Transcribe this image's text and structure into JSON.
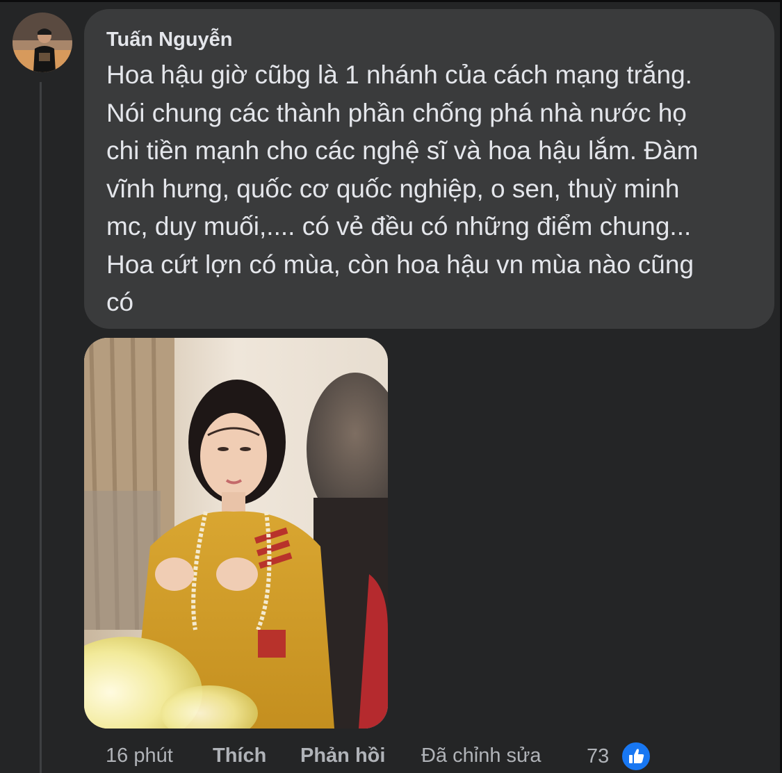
{
  "comment": {
    "author": "Tuấn Nguyễn",
    "lines": [
      "Hoa hậu giờ cũbg là 1 nhánh của cách mạng trắng.",
      "Nói chung các thành phần chống phá nhà nước họ",
      "chi tiền mạnh cho các nghệ sĩ và hoa hậu lắm. Đàm",
      "vĩnh hưng, quốc cơ quốc nghiệp, o sen, thuỳ minh",
      "mc, duy muối,.... có vẻ đều có những điểm chung...",
      "Hoa cứt lợn có mùa, còn hoa hậu vn mùa nào cũng",
      "có"
    ]
  },
  "actions": {
    "time": "16 phút",
    "like_label": "Thích",
    "reply_label": "Phản hồi",
    "edited_label": "Đã chỉnh sửa"
  },
  "reactions": {
    "count": "73",
    "icon": "thumbs-up-icon"
  },
  "colors": {
    "background": "#242526",
    "bubble": "#3a3b3c",
    "text": "#e4e6eb",
    "secondary_text": "#b0b3b8",
    "like_blue": "#1877f2"
  }
}
